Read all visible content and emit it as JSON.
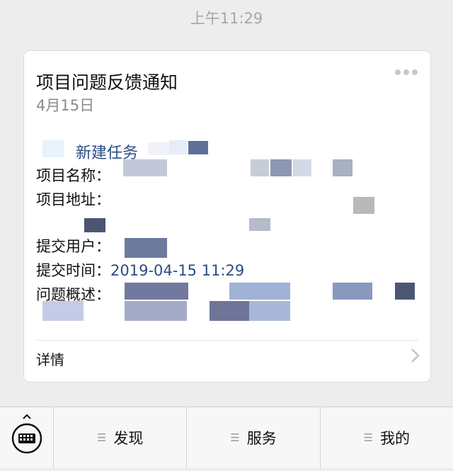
{
  "status_bar": {
    "time": "上午11:29"
  },
  "card": {
    "title": "项目问题反馈通知",
    "date": "4月15日",
    "task_label": "新建任务",
    "fields": {
      "project_name_label": "项目名称：",
      "project_address_label": "项目地址：",
      "submit_user_label": "提交用户：",
      "submit_time_label": "提交时间：",
      "submit_time_value": "2019-04-15 11:29",
      "summary_label": "问题概述："
    },
    "details_label": "详情"
  },
  "bottom_menu": {
    "items": [
      {
        "label": "发现"
      },
      {
        "label": "服务"
      },
      {
        "label": "我的"
      }
    ]
  },
  "colors": {
    "background": "#ededed",
    "link_blue": "#2b4d88",
    "card": "#ffffff"
  }
}
